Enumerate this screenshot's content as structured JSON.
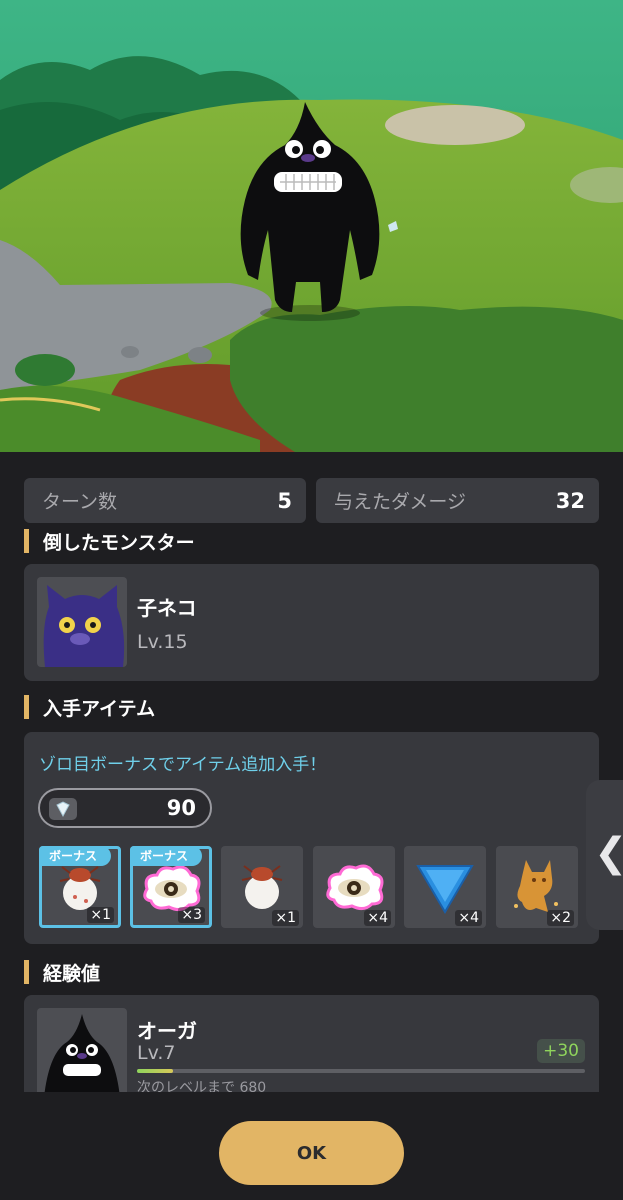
{
  "colors": {
    "accent": "#e2b565",
    "bonus": "#5cc1e6",
    "exp_gain": "#8fd45c",
    "panel": "#37383d"
  },
  "stats": {
    "turns_label": "ターン数",
    "turns_value": "5",
    "damage_label": "与えたダメージ",
    "damage_value": "32"
  },
  "defeated": {
    "title": "倒したモンスター",
    "monster_name": "子ネコ",
    "monster_level": "Lv.15",
    "monster_icon": "purple-cat-monster"
  },
  "items": {
    "title": "入手アイテム",
    "bonus_note": "ゾロ目ボーナスでアイテム追加入手！",
    "gem_icon": "diamond-icon",
    "gem_count": "90",
    "list": [
      {
        "icon": "tick-bug-egg-icon",
        "count": "×1",
        "bonus": true,
        "bonus_label": "ボーナス"
      },
      {
        "icon": "rainbow-eye-cloud-icon",
        "count": "×3",
        "bonus": true,
        "bonus_label": "ボーナス"
      },
      {
        "icon": "tick-bug-egg-icon",
        "count": "×1",
        "bonus": false
      },
      {
        "icon": "rainbow-eye-cloud-icon",
        "count": "×4",
        "bonus": false
      },
      {
        "icon": "blue-triangle-icon",
        "count": "×4",
        "bonus": false
      },
      {
        "icon": "golden-fox-icon",
        "count": "×2",
        "bonus": false
      }
    ]
  },
  "experience": {
    "title": "経験値",
    "character_name": "オーガ",
    "character_level": "Lv.7",
    "gain": "+30",
    "next_label": "次のレベルまで 680",
    "progress": 0.08
  },
  "side_tab_icon": "chevron-left-icon",
  "ok_label": "OK"
}
